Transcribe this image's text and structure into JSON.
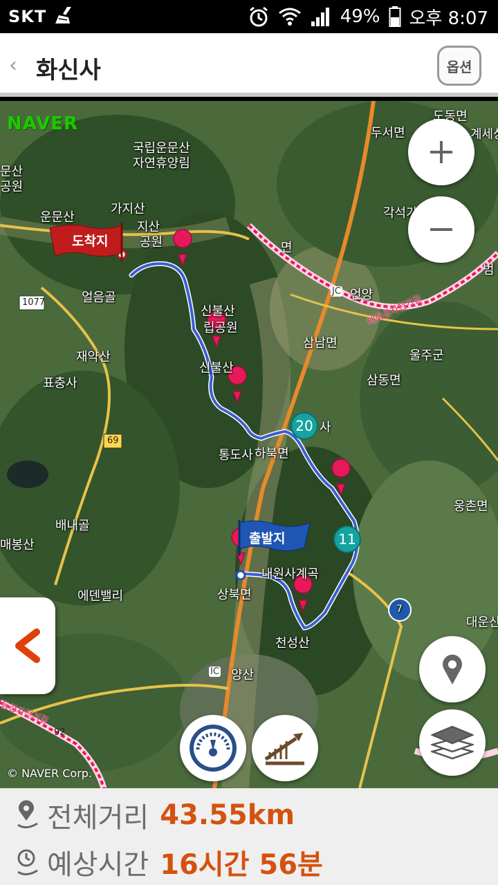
{
  "status_bar": {
    "carrier": "SKT",
    "battery": "49%",
    "time": "오후 8:07"
  },
  "header": {
    "title": "화신사",
    "option_label": "옵션"
  },
  "map": {
    "logo": "NAVER",
    "copyright": "© NAVER Corp.",
    "start_label": "출발지",
    "end_label": "도착지",
    "badges": [
      "20",
      "11"
    ],
    "labels": {
      "national_forest_1": "국립운문산",
      "national_forest_2": "자연휴양림",
      "gajisan": "가지산",
      "gajisan_park": "지산",
      "park": "공원",
      "unmunsan": "운문산",
      "munsan": "문산",
      "park_left": "공원",
      "eoreumgol": "얼음골",
      "jaeyaksan": "재약산",
      "pyochungsa": "표충사",
      "sinbulsan": "신불산",
      "sinbulsan_park": "립공원",
      "sinbul_ridge": "신불산",
      "tongdosa": "통도사",
      "habuk": "하북면",
      "naewon": "내원사계곡",
      "cheonseong": "천성산",
      "sangbuk": "상북면",
      "yangsan": "양산",
      "ic": "IC",
      "edenvalley": "에덴밸리",
      "baenaegol": "배내골",
      "maebongsan": "매봉산",
      "eonyang": "언양",
      "jc": "JC",
      "samnam": "삼남면",
      "ulju": "울주군",
      "samdong": "삼동면",
      "dusan": "두서면",
      "gakseok": "각석가",
      "ungchon": "웅촌면",
      "daeunsan": "대운산",
      "myeon": "면",
      "sa": "사",
      "dongmyeon": "도동면",
      "jesa": "계세상",
      "beom": "범",
      "road_1077": "1077",
      "road_69": "69",
      "road_7": "7",
      "road_92": "92",
      "taehwa": "태화강자전거길",
      "nakdong": "동강자전거길"
    },
    "accent_color": "#d4520f",
    "route_color": "#3a5fd0",
    "pin_color": "#e8195a"
  },
  "info": {
    "distance_label": "전체거리",
    "distance_value": "43.55km",
    "time_label": "예상시간",
    "time_value": "16시간 56분"
  }
}
